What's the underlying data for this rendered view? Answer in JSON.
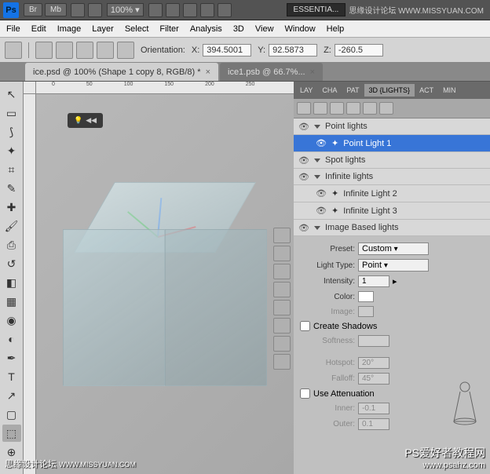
{
  "topbar": {
    "ps": "Ps",
    "br": "Br",
    "mb": "Mb",
    "zoom": "100%",
    "essentials": "ESSENTIA..."
  },
  "menu": {
    "file": "File",
    "edit": "Edit",
    "image": "Image",
    "layer": "Layer",
    "select": "Select",
    "filter": "Filter",
    "analysis": "Analysis",
    "3d": "3D",
    "view": "View",
    "window": "Window",
    "help": "Help"
  },
  "options": {
    "orientation": "Orientation:",
    "xlabel": "X:",
    "x": "394.5001",
    "ylabel": "Y:",
    "y": "92.5873",
    "zlabel": "Z:",
    "z": "-260.5"
  },
  "tabs": {
    "t1": "ice.psd @ 100% (Shape 1 copy 8, RGB/8) *",
    "t2": "ice1.psb @ 66.7%..."
  },
  "minipanel": {
    "arrows": "◀◀"
  },
  "panels": {
    "ptabs": {
      "lay": "LAY",
      "cha": "CHA",
      "pat": "PAT",
      "d3": "3D {LIGHTS}",
      "act": "ACT",
      "min": "MIN"
    },
    "lights": {
      "point_group": "Point lights",
      "point1": "Point Light 1",
      "spot_group": "Spot lights",
      "infinite_group": "Infinite lights",
      "inf2": "Infinite Light 2",
      "inf3": "Infinite Light 3",
      "image_group": "Image Based lights"
    },
    "props": {
      "preset_l": "Preset:",
      "preset_v": "Custom",
      "lighttype_l": "Light Type:",
      "lighttype_v": "Point",
      "intensity_l": "Intensity:",
      "intensity_v": "1",
      "color_l": "Color:",
      "image_l": "Image:",
      "shadows": "Create Shadows",
      "softness_l": "Softness:",
      "hotspot_l": "Hotspot:",
      "hotspot_v": "20°",
      "falloff_l": "Falloff:",
      "falloff_v": "45°",
      "atten": "Use Attenuation",
      "inner_l": "Inner:",
      "inner_v": "-0.1",
      "outer_l": "Outer:",
      "outer_v": "0.1"
    }
  },
  "watermarks": {
    "topright": "思缘设计论坛 WWW.MISSYUAN.COM",
    "bl1": "思缘设计论坛",
    "bl2": "WWW.MISSYUAN.COM",
    "br1": "PS爱好者教程网",
    "br2": "www.psahz.com"
  }
}
